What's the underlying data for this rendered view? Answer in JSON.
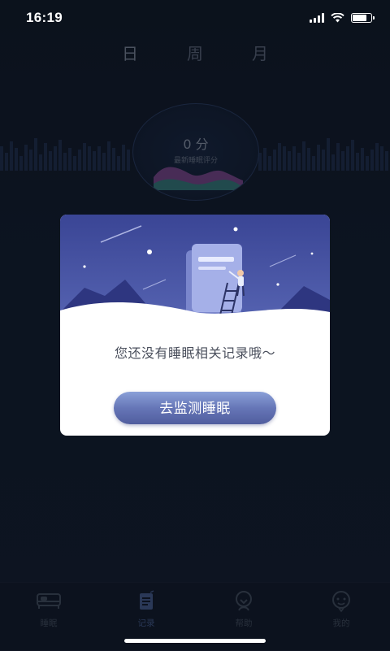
{
  "status_bar": {
    "time": "16:19"
  },
  "period_tabs": [
    "日",
    "周",
    "月"
  ],
  "score": {
    "value": "0 分",
    "label": "最新睡眠评分"
  },
  "modal": {
    "message": "您还没有睡眠相关记录哦～",
    "button_label": "去监测睡眠"
  },
  "tabbar": {
    "items": [
      {
        "label": "睡眠",
        "icon": "bed-icon"
      },
      {
        "label": "记录",
        "icon": "clipboard-icon"
      },
      {
        "label": "帮助",
        "icon": "help-icon"
      },
      {
        "label": "我的",
        "icon": "profile-icon"
      }
    ]
  },
  "colors": {
    "background": "#0e1523",
    "accent": "#6676b7",
    "modal_illustration": "#4d5aa6"
  }
}
